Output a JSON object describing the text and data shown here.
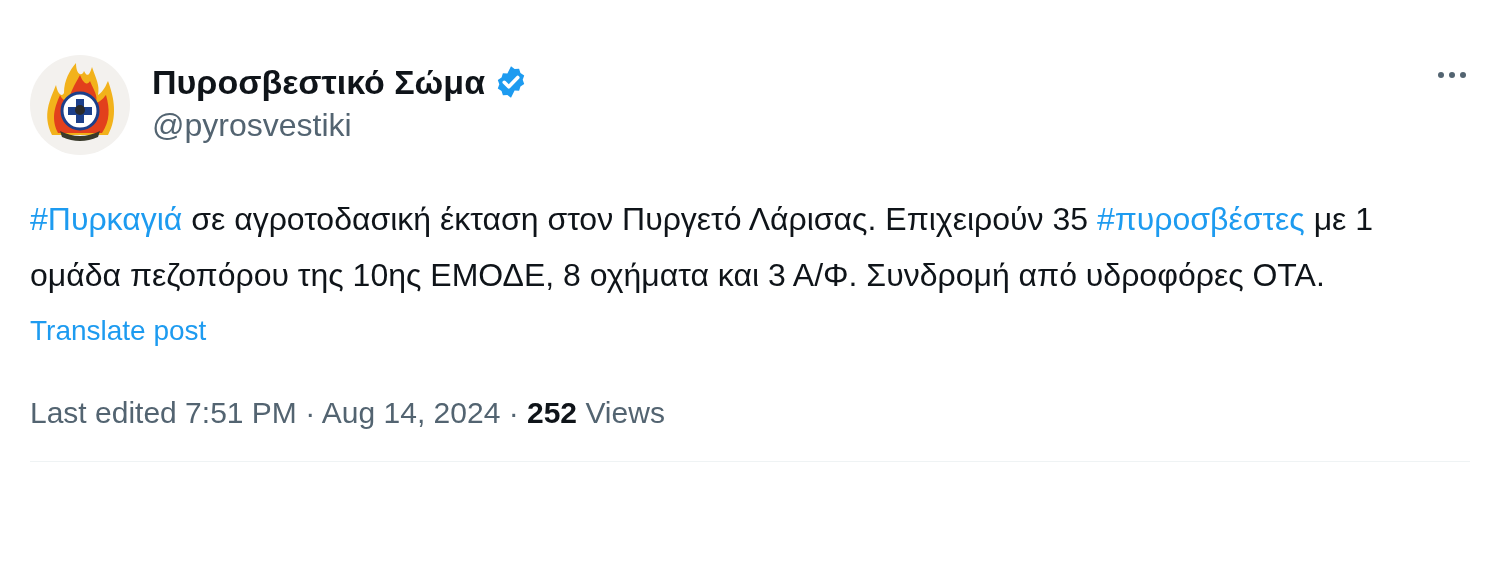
{
  "author": {
    "name": "Πυροσβεστικό Σώμα",
    "verified": true,
    "handle": "@pyrosvestiki"
  },
  "post": {
    "segments": [
      {
        "kind": "hashtag",
        "text": "#Πυρκαγιά"
      },
      {
        "kind": "text",
        "text": " σε αγροτοδασική έκταση στον Πυργετό Λάρισας. Επιχειρούν 35 "
      },
      {
        "kind": "hashtag",
        "text": "#πυροσβέστες"
      },
      {
        "kind": "text",
        "text": " με 1 ομάδα πεζοπόρου της 10ης ΕΜΟΔΕ, 8 οχήματα και 3 Α/Φ. Συνδρομή από υδροφόρες ΟΤΑ."
      }
    ]
  },
  "translate_link": "Translate post",
  "meta": "Last edited 7:51 PM · Aug 14, 2024 · **252** Views"
}
